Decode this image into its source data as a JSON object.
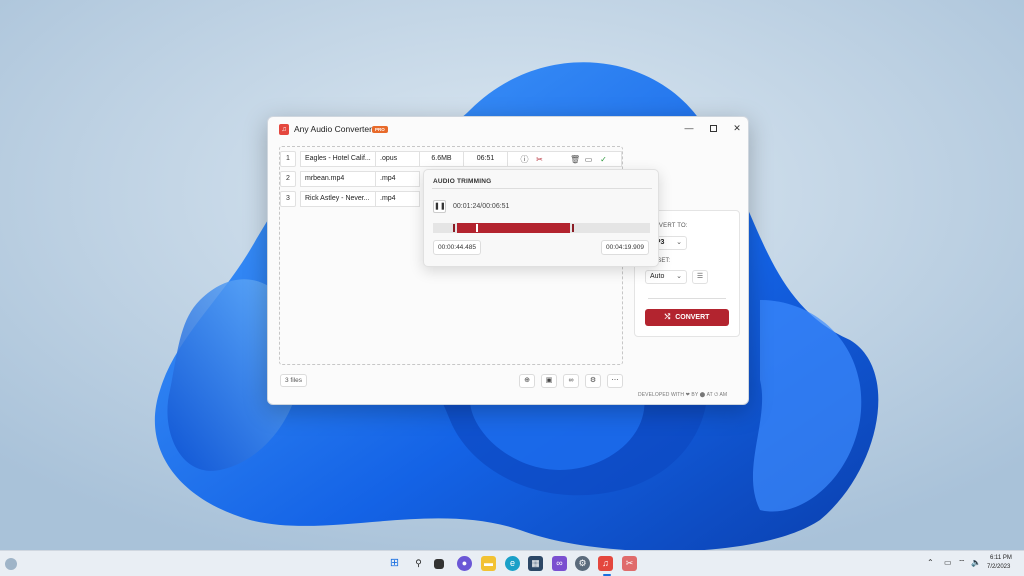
{
  "window": {
    "title": "Any Audio Converter",
    "badge": "PRO",
    "minimize": "—",
    "close": "✕"
  },
  "files": [
    {
      "index": "1",
      "name": "Eagles - Hotel Calif...",
      "format": ".opus",
      "size": "6.6MB",
      "duration": "06:51"
    },
    {
      "index": "2",
      "name": "mrbean.mp4",
      "format": ".mp4"
    },
    {
      "index": "3",
      "name": "Rick Astley - Never...",
      "format": ".mp4"
    }
  ],
  "files_count": "3 files",
  "trimming": {
    "title": "AUDIO TRIMMING",
    "current_time": "00:01:24/00:06:51",
    "start_time": "00:00:44.485",
    "end_time": "00:04:19.909",
    "selection_start_fraction": 0.11,
    "selection_end_fraction": 0.63,
    "position_fraction": 0.2
  },
  "settings": {
    "convert_to_label": "CONVERT TO:",
    "format_value": "MP3",
    "preset_label": "PRESET:",
    "preset_value": "Auto",
    "convert_button": "CONVERT"
  },
  "footer": {
    "credit": "DEVELOPED WITH ❤ BY ⬤ AT ⏻ AM"
  },
  "taskbar": {
    "time": "6:11 PM",
    "date": "7/2/2023"
  },
  "colors": {
    "accent": "#b3242f",
    "pro_badge": "#e86a2a"
  }
}
